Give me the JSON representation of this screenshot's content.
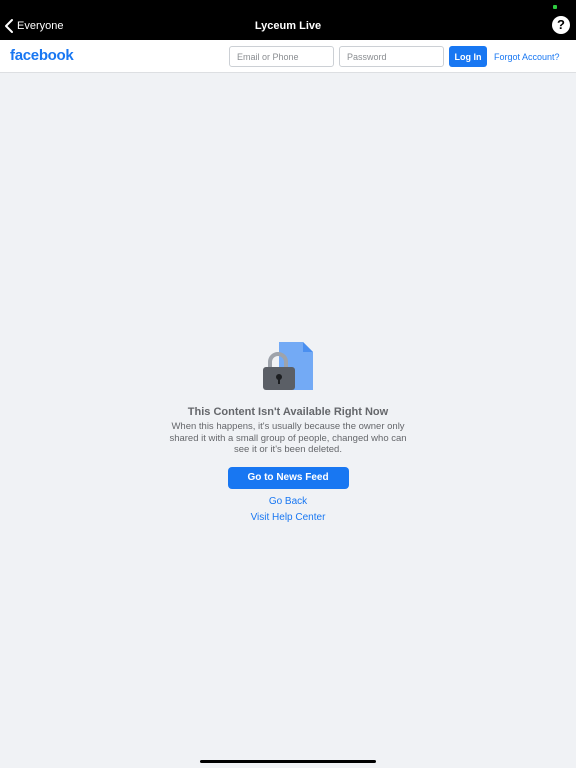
{
  "nav": {
    "back_label": "Everyone",
    "title": "Lyceum Live",
    "help_label": "?"
  },
  "header": {
    "logo": "facebook",
    "email_placeholder": "Email or Phone",
    "password_placeholder": "Password",
    "login_label": "Log In",
    "forgot_label": "Forgot Account?"
  },
  "content": {
    "icon": "lock-icon",
    "title": "This Content Isn't Available Right Now",
    "body": "When this happens, it's usually because the owner only shared it with a small group of people, changed who can see it or it's been deleted.",
    "primary_button": "Go to News Feed",
    "go_back": "Go Back",
    "help_center": "Visit Help Center"
  },
  "colors": {
    "brand": "#1877f2",
    "background": "#f0f2f5",
    "muted_text": "#65676b"
  }
}
